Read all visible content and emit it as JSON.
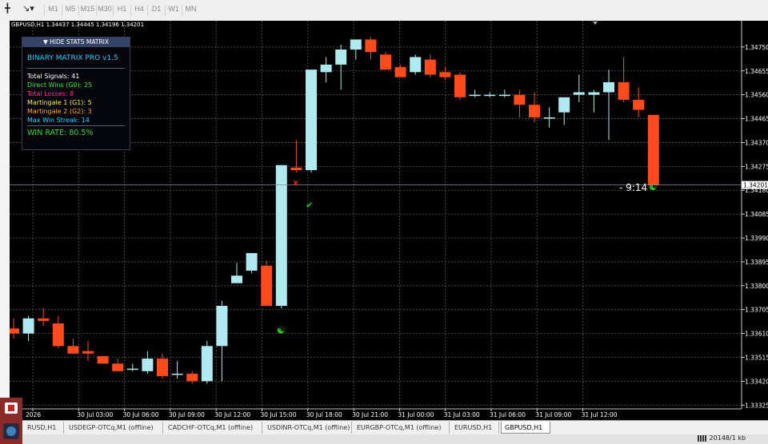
{
  "toolbar": {
    "timeframes": [
      "M1",
      "M5",
      "M15",
      "M30",
      "H1",
      "H4",
      "D1",
      "W1",
      "MN"
    ]
  },
  "chart_info": "GBPUSD,H1  1.34437 1.34445 1.34196 1.34201",
  "stats": {
    "header": "▼ HIDE STATS MATRIX",
    "title": "BINARY MATRIX PRO v1.5",
    "lines": [
      {
        "text": "Total Signals: 41",
        "color": "#ffffff"
      },
      {
        "text": "Direct Wins (G0): 25",
        "color": "#33ee33"
      },
      {
        "text": "Total Losses: 8",
        "color": "#ff3399"
      },
      {
        "text": "Martingale 1 (G1): 5",
        "color": "#ffee44"
      },
      {
        "text": "Martingale 2 (G2): 3",
        "color": "#ffaa22"
      },
      {
        "text": "Max Win Streak: 14",
        "color": "#33ccff"
      }
    ],
    "win_rate": "WIN RATE: 80.5%"
  },
  "timer": "- 9:14",
  "current_price": "1.34201",
  "chart_data": {
    "type": "candlestick",
    "symbol": "GBPUSD",
    "timeframe": "H1",
    "y_ticks": [
      "1.34750",
      "1.34655",
      "1.34560",
      "1.34465",
      "1.34370",
      "1.34275",
      "1.34180",
      "1.34085",
      "1.33990",
      "1.33895",
      "1.33800",
      "1.33705",
      "1.33610",
      "1.33515",
      "1.33420",
      "1.33325"
    ],
    "ylim": [
      1.3331,
      1.3481
    ],
    "x_ticks": [
      "2026",
      "30 Jul 03:00",
      "30 Jul 06:00",
      "30 Jul 09:00",
      "30 Jul 12:00",
      "30 Jul 15:00",
      "30 Jul 18:00",
      "30 Jul 21:00",
      "31 Jul 00:00",
      "31 Jul 03:00",
      "31 Jul 06:00",
      "31 Jul 09:00",
      "31 Jul 12:00"
    ],
    "colors": {
      "bull": "#aeeaf0",
      "bear": "#ff4a1c",
      "grid": "#5a5a5a",
      "marker": "#22cc22"
    },
    "candles": [
      {
        "o": 1.3363,
        "h": 1.3367,
        "l": 1.3359,
        "c": 1.3361
      },
      {
        "o": 1.3361,
        "h": 1.3368,
        "l": 1.3358,
        "c": 1.3367
      },
      {
        "o": 1.3367,
        "h": 1.3371,
        "l": 1.3364,
        "c": 1.3366
      },
      {
        "o": 1.3365,
        "h": 1.3368,
        "l": 1.3355,
        "c": 1.3356
      },
      {
        "o": 1.3356,
        "h": 1.3359,
        "l": 1.3353,
        "c": 1.3353
      },
      {
        "o": 1.3354,
        "h": 1.3358,
        "l": 1.335,
        "c": 1.3353
      },
      {
        "o": 1.3352,
        "h": 1.3352,
        "l": 1.3349,
        "c": 1.3349
      },
      {
        "o": 1.3349,
        "h": 1.3351,
        "l": 1.3346,
        "c": 1.3346
      },
      {
        "o": 1.3347,
        "h": 1.3349,
        "l": 1.3346,
        "c": 1.3347
      },
      {
        "o": 1.3346,
        "h": 1.3354,
        "l": 1.3345,
        "c": 1.3351
      },
      {
        "o": 1.3351,
        "h": 1.3353,
        "l": 1.3343,
        "c": 1.3344
      },
      {
        "o": 1.3345,
        "h": 1.335,
        "l": 1.3343,
        "c": 1.3345
      },
      {
        "o": 1.3345,
        "h": 1.3346,
        "l": 1.3341,
        "c": 1.3342
      },
      {
        "o": 1.3342,
        "h": 1.3358,
        "l": 1.3341,
        "c": 1.3356
      },
      {
        "o": 1.3356,
        "h": 1.3374,
        "l": 1.3342,
        "c": 1.3372
      },
      {
        "o": 1.3381,
        "h": 1.3389,
        "l": 1.3381,
        "c": 1.3384
      },
      {
        "o": 1.3386,
        "h": 1.3393,
        "l": 1.3385,
        "c": 1.3393
      },
      {
        "o": 1.3388,
        "h": 1.339,
        "l": 1.3372,
        "c": 1.3372
      },
      {
        "o": 1.3372,
        "h": 1.3428,
        "l": 1.3371,
        "c": 1.3428
      },
      {
        "o": 1.3427,
        "h": 1.3438,
        "l": 1.3425,
        "c": 1.3426
      },
      {
        "o": 1.3426,
        "h": 1.3466,
        "l": 1.3425,
        "c": 1.3466
      },
      {
        "o": 1.3465,
        "h": 1.3471,
        "l": 1.3461,
        "c": 1.3468
      },
      {
        "o": 1.3468,
        "h": 1.3476,
        "l": 1.3458,
        "c": 1.3474
      },
      {
        "o": 1.3474,
        "h": 1.3478,
        "l": 1.347,
        "c": 1.3478
      },
      {
        "o": 1.3478,
        "h": 1.3479,
        "l": 1.347,
        "c": 1.3473
      },
      {
        "o": 1.3472,
        "h": 1.3473,
        "l": 1.3466,
        "c": 1.3466
      },
      {
        "o": 1.3467,
        "h": 1.3468,
        "l": 1.3463,
        "c": 1.3463
      },
      {
        "o": 1.3465,
        "h": 1.3472,
        "l": 1.3464,
        "c": 1.3471
      },
      {
        "o": 1.347,
        "h": 1.3472,
        "l": 1.3463,
        "c": 1.3464
      },
      {
        "o": 1.3465,
        "h": 1.3467,
        "l": 1.3462,
        "c": 1.3463
      },
      {
        "o": 1.3464,
        "h": 1.3465,
        "l": 1.3454,
        "c": 1.3455
      },
      {
        "o": 1.3456,
        "h": 1.3458,
        "l": 1.3455,
        "c": 1.3456
      },
      {
        "o": 1.3456,
        "h": 1.3457,
        "l": 1.3455,
        "c": 1.3456
      },
      {
        "o": 1.3456,
        "h": 1.3458,
        "l": 1.3455,
        "c": 1.3456
      },
      {
        "o": 1.3456,
        "h": 1.3458,
        "l": 1.3447,
        "c": 1.3452
      },
      {
        "o": 1.3452,
        "h": 1.3457,
        "l": 1.3445,
        "c": 1.3447
      },
      {
        "o": 1.3447,
        "h": 1.3451,
        "l": 1.3443,
        "c": 1.3447
      },
      {
        "o": 1.3449,
        "h": 1.3455,
        "l": 1.3444,
        "c": 1.3455
      },
      {
        "o": 1.3456,
        "h": 1.3464,
        "l": 1.3453,
        "c": 1.3457
      },
      {
        "o": 1.3456,
        "h": 1.3458,
        "l": 1.3449,
        "c": 1.3457
      },
      {
        "o": 1.3457,
        "h": 1.3466,
        "l": 1.3438,
        "c": 1.3461
      },
      {
        "o": 1.3461,
        "h": 1.3471,
        "l": 1.3453,
        "c": 1.3454
      },
      {
        "o": 1.3454,
        "h": 1.3459,
        "l": 1.3447,
        "c": 1.345
      },
      {
        "o": 1.3448,
        "h": 1.3448,
        "l": 1.342,
        "c": 1.342
      }
    ],
    "annotations": [
      {
        "type": "loss-x",
        "text": "x",
        "candle": 19,
        "price": 1.342
      },
      {
        "type": "win-check",
        "text": "✔",
        "candle": 20,
        "price": 1.3411
      },
      {
        "type": "signal-yinyang",
        "text": "☯",
        "candle": 18,
        "price": 1.3361
      },
      {
        "type": "signal-yinyang",
        "text": "☯",
        "candle": 43,
        "price": 1.3418
      }
    ]
  },
  "tabs": [
    "RUSD,H1",
    "USDEGP-OTCq,M1 (offline)",
    "CADCHF-OTCq,M1 (offline)",
    "USDINR-OTCq,M1 (offline)",
    "EURGBP-OTCq,M1 (offline)",
    "EURUSD,H1",
    "GBPUSD,H1"
  ],
  "active_tab": "GBPUSD,H1",
  "status": "20148/1 kb"
}
